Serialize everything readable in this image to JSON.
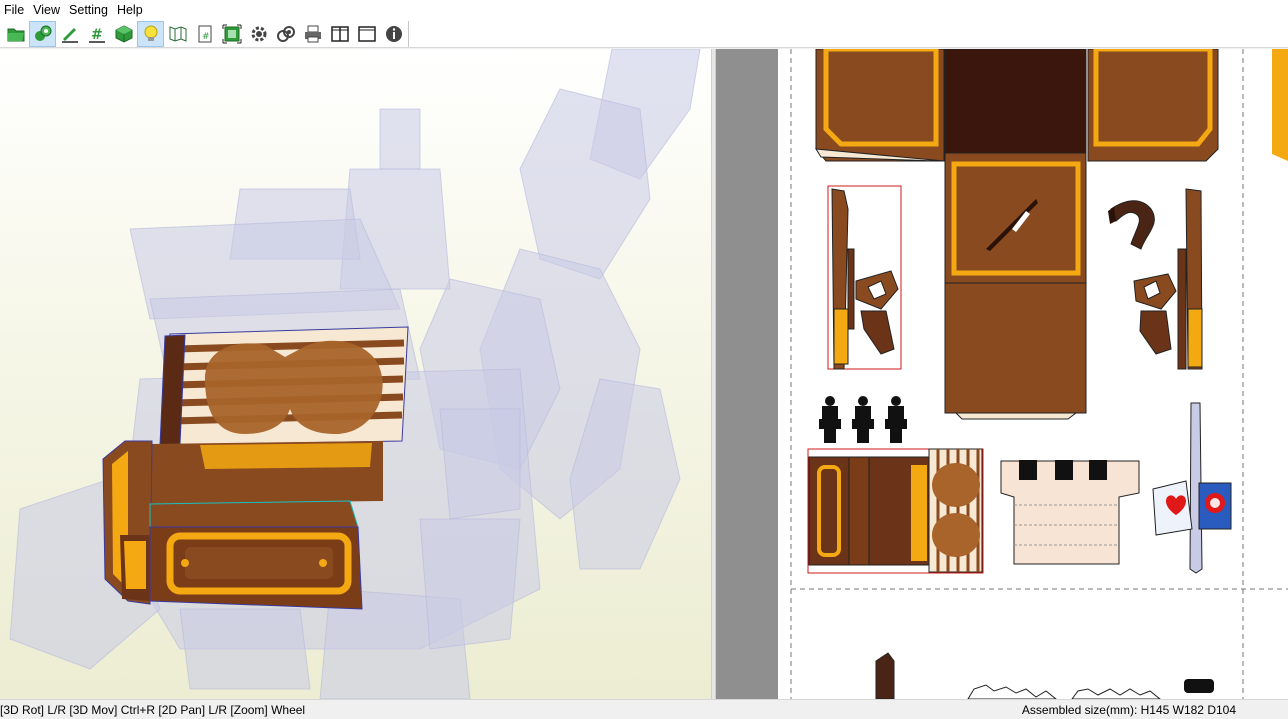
{
  "menu": {
    "file": "File",
    "view": "View",
    "setting": "Setting",
    "help": "Help"
  },
  "toolbar": {
    "buttons": [
      {
        "icon": "open-folder-icon",
        "active": false
      },
      {
        "icon": "3d-model-icon",
        "active": true
      },
      {
        "icon": "edit-pen-icon",
        "active": false
      },
      {
        "icon": "number-icon",
        "active": false
      },
      {
        "icon": "cube-icon",
        "active": false
      },
      {
        "icon": "lightbulb-icon",
        "active": true
      },
      {
        "icon": "unfold-map-icon",
        "active": false
      },
      {
        "icon": "page-number-icon",
        "active": false
      },
      {
        "icon": "fit-view-icon",
        "active": false
      },
      {
        "icon": "gear-icon",
        "active": false
      },
      {
        "icon": "link-icon",
        "active": false
      },
      {
        "icon": "printer-icon",
        "active": false
      },
      {
        "icon": "two-pane-icon",
        "active": false
      },
      {
        "icon": "single-pane-icon",
        "active": false
      },
      {
        "icon": "info-icon",
        "active": false
      }
    ]
  },
  "colors": {
    "brown_dark": "#4a2414",
    "brown": "#8a4a20",
    "brown_mid": "#6b3418",
    "gold": "#f4a812",
    "ghost": "#c9cbe6",
    "cream": "#f6e8d2",
    "cut_line_red": "#d01818"
  },
  "status": {
    "controls_hint": "[3D Rot] L/R [3D Mov] Ctrl+R [2D Pan] L/R [Zoom] Wheel",
    "assembled_size": "Assembled size(mm): H145 W182 D104"
  }
}
